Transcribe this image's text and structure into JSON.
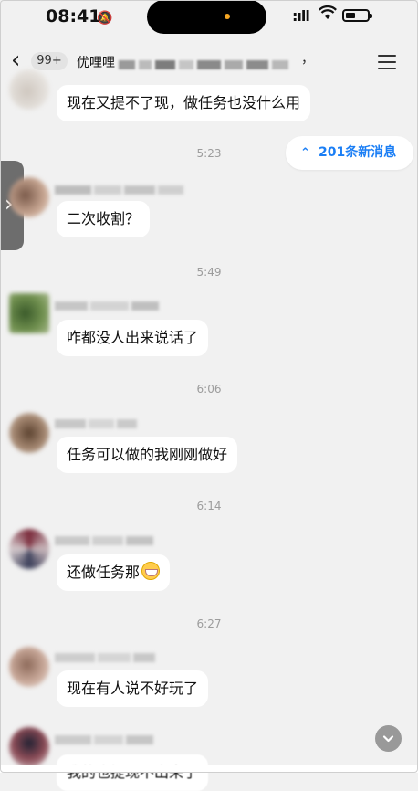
{
  "status": {
    "time": "08:41"
  },
  "nav": {
    "back_badge": "99+",
    "group_name": "优哩哩",
    "title_tail": "，"
  },
  "new_messages": {
    "label": "201条新消息"
  },
  "messages": [
    {
      "text": "现在又提不了现，做任务也没什么用"
    },
    {
      "time": "5:23",
      "text": "二次收割？"
    },
    {
      "time": "5:49",
      "text": "咋都没人出来说话了"
    },
    {
      "time": "6:06",
      "text": "任务可以做的我刚刚做好"
    },
    {
      "time": "6:14",
      "text": "还做任务那"
    },
    {
      "time": "6:27",
      "text": "现在有人说不好玩了"
    },
    {
      "text": "我的也提现不出来了"
    }
  ],
  "colors": {
    "accent": "#1a7ef5",
    "background": "#f1f1f1",
    "bubble": "#ffffff"
  }
}
